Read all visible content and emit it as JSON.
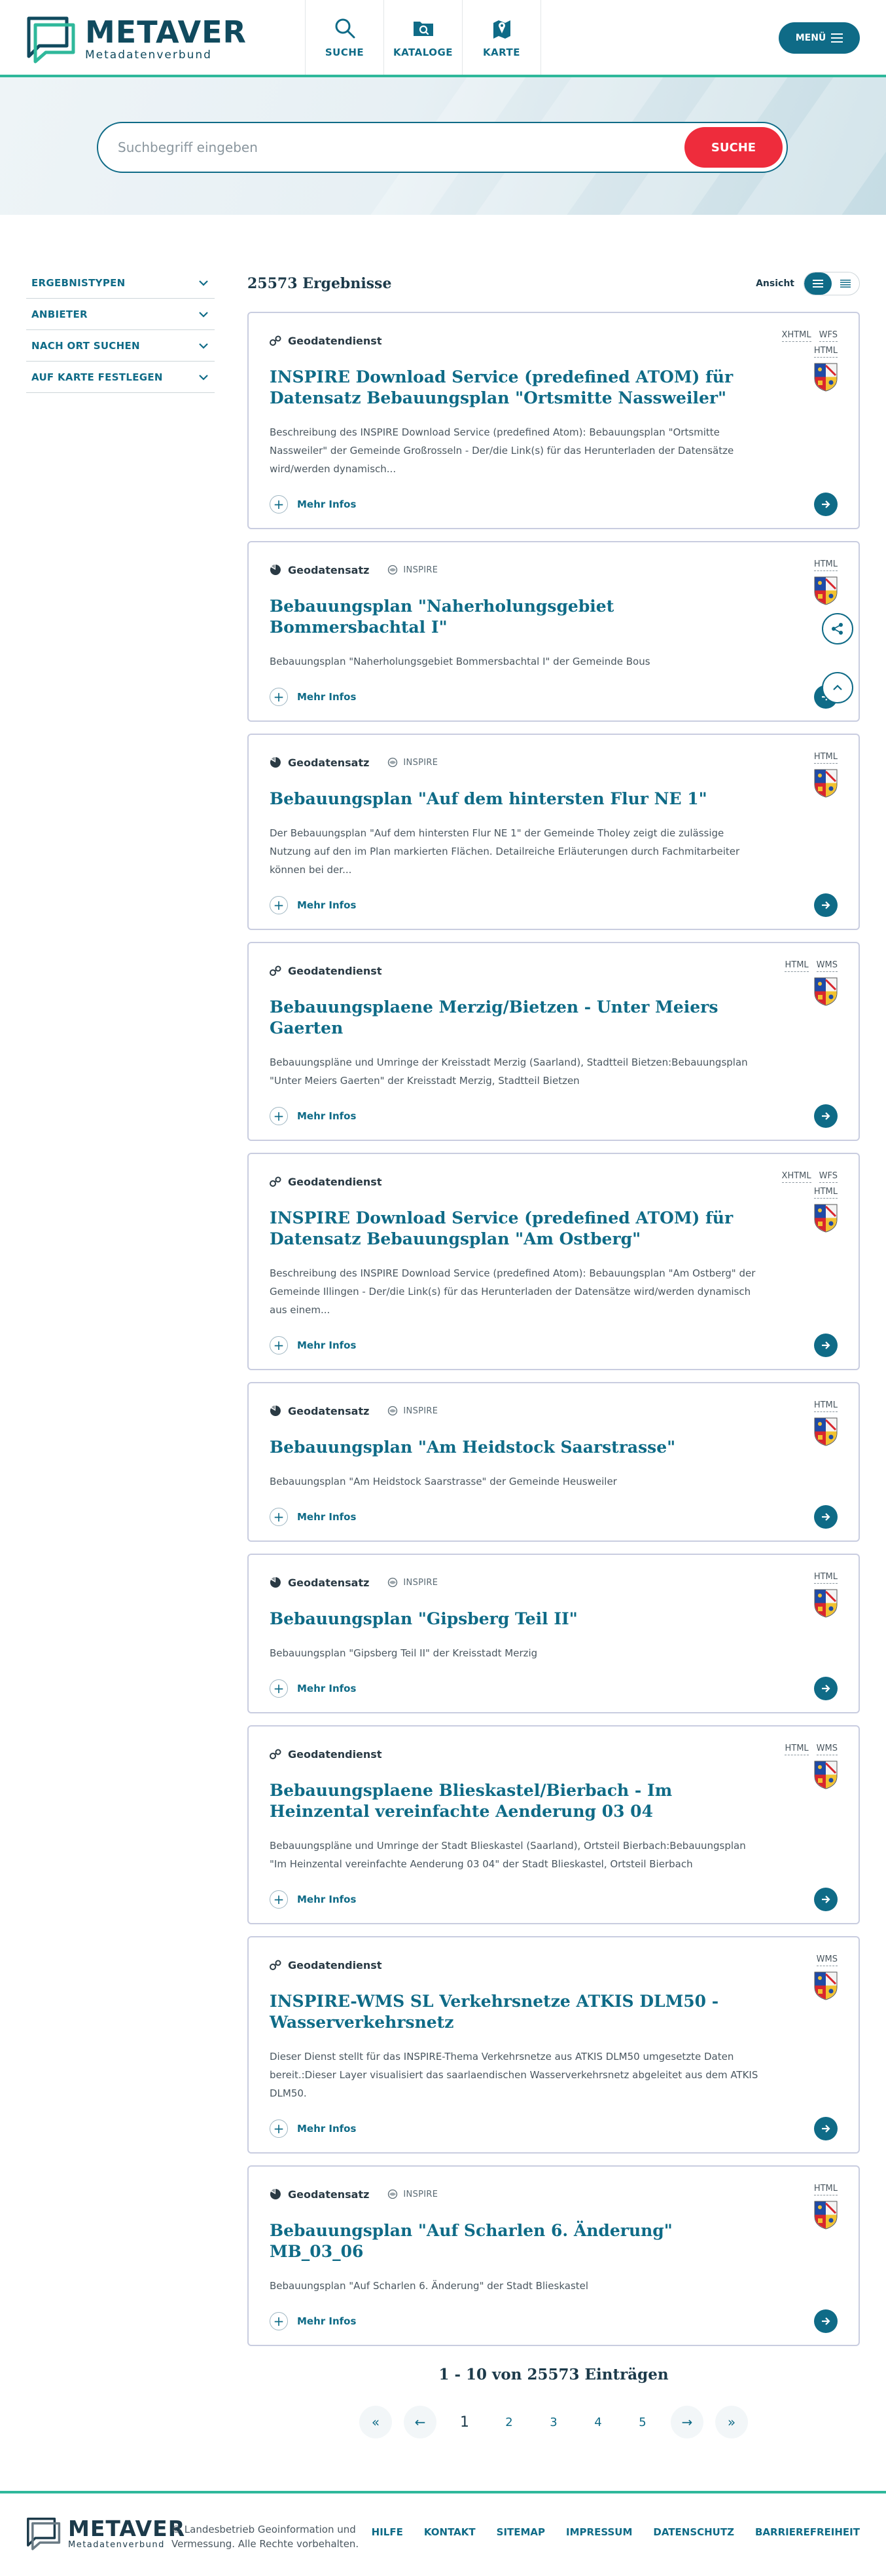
{
  "header": {
    "logo_title": "METAVER",
    "logo_subtitle": "Metadatenverbund",
    "nav": [
      {
        "label": "SUCHE",
        "icon": "search-icon"
      },
      {
        "label": "KATALOGE",
        "icon": "catalog-icon"
      },
      {
        "label": "KARTE",
        "icon": "map-icon"
      }
    ],
    "menu_label": "MENÜ"
  },
  "search": {
    "placeholder": "Suchbegriff eingeben",
    "button_label": "SUCHE"
  },
  "sidebar": {
    "filters": [
      "ERGEBNISTYPEN",
      "ANBIETER",
      "NACH ORT SUCHEN",
      "AUF KARTE FESTLEGEN"
    ]
  },
  "results": {
    "count_label": "25573 Ergebnisse",
    "view_label": "Ansicht",
    "more_label": "Mehr Infos",
    "items": [
      {
        "type": "Geodatendienst",
        "inspire": "",
        "formats_top": [
          "XHTML",
          "WFS"
        ],
        "formats_bottom": [
          "HTML"
        ],
        "title": "INSPIRE Download Service (predefined ATOM) für Datensatz Bebauungsplan \"Ortsmitte Nassweiler\"",
        "desc": "Beschreibung des INSPIRE Download Service (predefined Atom): Bebauungsplan \"Ortsmitte Nassweiler\" der Gemeinde Großrosseln - Der/die Link(s) für das Herunterladen der Datensätze wird/werden dynamisch..."
      },
      {
        "type": "Geodatensatz",
        "inspire": "INSPIRE",
        "formats_top": [
          "HTML"
        ],
        "formats_bottom": [],
        "title": "Bebauungsplan \"Naherholungsgebiet Bommersbachtal I\"",
        "desc": "Bebauungsplan \"Naherholungsgebiet Bommersbachtal I\" der Gemeinde Bous"
      },
      {
        "type": "Geodatensatz",
        "inspire": "INSPIRE",
        "formats_top": [
          "HTML"
        ],
        "formats_bottom": [],
        "title": "Bebauungsplan \"Auf dem hintersten Flur NE 1\"",
        "desc": "Der Bebauungsplan \"Auf dem hintersten Flur NE 1\" der Gemeinde Tholey zeigt die zulässige Nutzung auf den im Plan markierten Flächen. Detailreiche Erläuterungen durch Fachmitarbeiter können bei der..."
      },
      {
        "type": "Geodatendienst",
        "inspire": "",
        "formats_top": [
          "HTML",
          "WMS"
        ],
        "formats_bottom": [],
        "title": "Bebauungsplaene Merzig/Bietzen - Unter Meiers Gaerten",
        "desc": "Bebauungspläne und Umringe der Kreisstadt Merzig (Saarland), Stadtteil Bietzen:Bebauungsplan \"Unter Meiers Gaerten\" der Kreisstadt Merzig, Stadtteil Bietzen"
      },
      {
        "type": "Geodatendienst",
        "inspire": "",
        "formats_top": [
          "XHTML",
          "WFS"
        ],
        "formats_bottom": [
          "HTML"
        ],
        "title": "INSPIRE Download Service (predefined ATOM) für Datensatz Bebauungsplan \"Am Ostberg\"",
        "desc": "Beschreibung des INSPIRE Download Service (predefined Atom): Bebauungsplan \"Am Ostberg\" der Gemeinde Illingen - Der/die Link(s) für das Herunterladen der Datensätze wird/werden dynamisch aus einem..."
      },
      {
        "type": "Geodatensatz",
        "inspire": "INSPIRE",
        "formats_top": [
          "HTML"
        ],
        "formats_bottom": [],
        "title": "Bebauungsplan \"Am Heidstock Saarstrasse\"",
        "desc": "Bebauungsplan \"Am Heidstock Saarstrasse\" der Gemeinde Heusweiler"
      },
      {
        "type": "Geodatensatz",
        "inspire": "INSPIRE",
        "formats_top": [
          "HTML"
        ],
        "formats_bottom": [],
        "title": "Bebauungsplan \"Gipsberg Teil II\"",
        "desc": "Bebauungsplan \"Gipsberg Teil II\" der Kreisstadt Merzig"
      },
      {
        "type": "Geodatendienst",
        "inspire": "",
        "formats_top": [
          "HTML",
          "WMS"
        ],
        "formats_bottom": [],
        "title": "Bebauungsplaene Blieskastel/Bierbach - Im Heinzental vereinfachte Aenderung 03 04",
        "desc": "Bebauungspläne und Umringe der Stadt Blieskastel (Saarland), Ortsteil Bierbach:Bebauungsplan \"Im Heinzental vereinfachte Aenderung 03 04\" der Stadt Blieskastel, Ortsteil Bierbach"
      },
      {
        "type": "Geodatendienst",
        "inspire": "",
        "formats_top": [
          "WMS"
        ],
        "formats_bottom": [],
        "title": "INSPIRE-WMS SL Verkehrsnetze ATKIS DLM50 - Wasserverkehrsnetz",
        "desc": "Dieser Dienst stellt für das INSPIRE-Thema Verkehrsnetze aus ATKIS DLM50 umgesetzte Daten bereit.:Dieser Layer visualisiert das saarlaendischen Wasserverkehrsnetz abgeleitet aus dem ATKIS DLM50."
      },
      {
        "type": "Geodatensatz",
        "inspire": "INSPIRE",
        "formats_top": [
          "HTML"
        ],
        "formats_bottom": [],
        "title": "Bebauungsplan \"Auf Scharlen 6. Änderung\" MB_03_06",
        "desc": "Bebauungsplan \"Auf Scharlen 6. Änderung\" der Stadt Blieskastel"
      }
    ]
  },
  "pagination": {
    "summary": "1 - 10 von 25573 Einträgen",
    "first": "«",
    "prev": "←",
    "pages": [
      "1",
      "2",
      "3",
      "4",
      "5"
    ],
    "current": "1",
    "next": "→",
    "last": "»"
  },
  "footer": {
    "logo_title": "METAVER",
    "logo_subtitle": "Metadatenverbund",
    "copyright": "© Landesbetrieb Geoinformation und Vermessung. Alle Rechte vorbehalten.",
    "links": [
      "HILFE",
      "KONTAKT",
      "SITEMAP",
      "IMPRESSUM",
      "DATENSCHUTZ",
      "BARRIEREFREIHEIT"
    ]
  },
  "colors": {
    "brand": "#0f6b87",
    "accent": "#2fb89b",
    "search_button": "#ee2c3c"
  }
}
